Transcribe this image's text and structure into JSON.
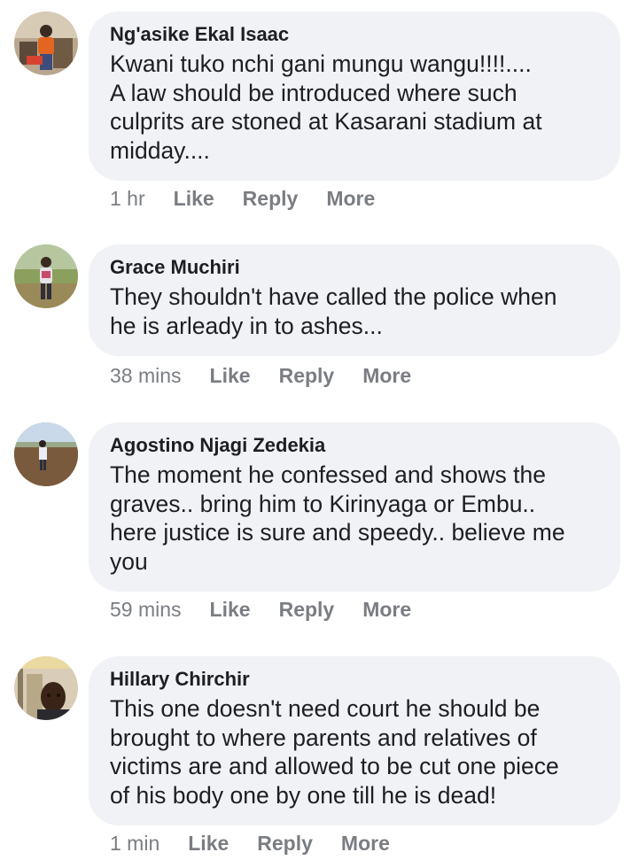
{
  "comments": [
    {
      "author": "Ng'asike Ekal Isaac",
      "text": "Kwani tuko nchi gani mungu wangu!!!!....\nA law should be introduced where such\nculprits are stoned at Kasarani stadium at\nmidday....",
      "time": "1 hr",
      "like": "Like",
      "reply": "Reply",
      "more": "More"
    },
    {
      "author": "Grace Muchiri",
      "text": "They shouldn't have called the police when\nhe is arleady in to ashes...",
      "time": "38 mins",
      "like": "Like",
      "reply": "Reply",
      "more": "More"
    },
    {
      "author": "Agostino Njagi Zedekia",
      "text": "The moment he confessed and shows the\ngraves.. bring him to Kirinyaga or Embu..\nhere justice is sure and speedy.. believe me\nyou",
      "time": "59 mins",
      "like": "Like",
      "reply": "Reply",
      "more": "More"
    },
    {
      "author": "Hillary Chirchir",
      "text": "This one doesn't need court he should be\nbrought to where parents and relatives of\nvictims are and allowed to be cut one piece\nof his body one by one till he is dead!",
      "time": "1 min",
      "like": "Like",
      "reply": "Reply",
      "more": "More"
    }
  ],
  "colors": {
    "bubble": "#f0f2f5",
    "text": "#1c1e21",
    "meta": "#7a7d82"
  },
  "icons": [
    "avatar-photo-1",
    "avatar-photo-2",
    "avatar-photo-3",
    "avatar-photo-4"
  ]
}
